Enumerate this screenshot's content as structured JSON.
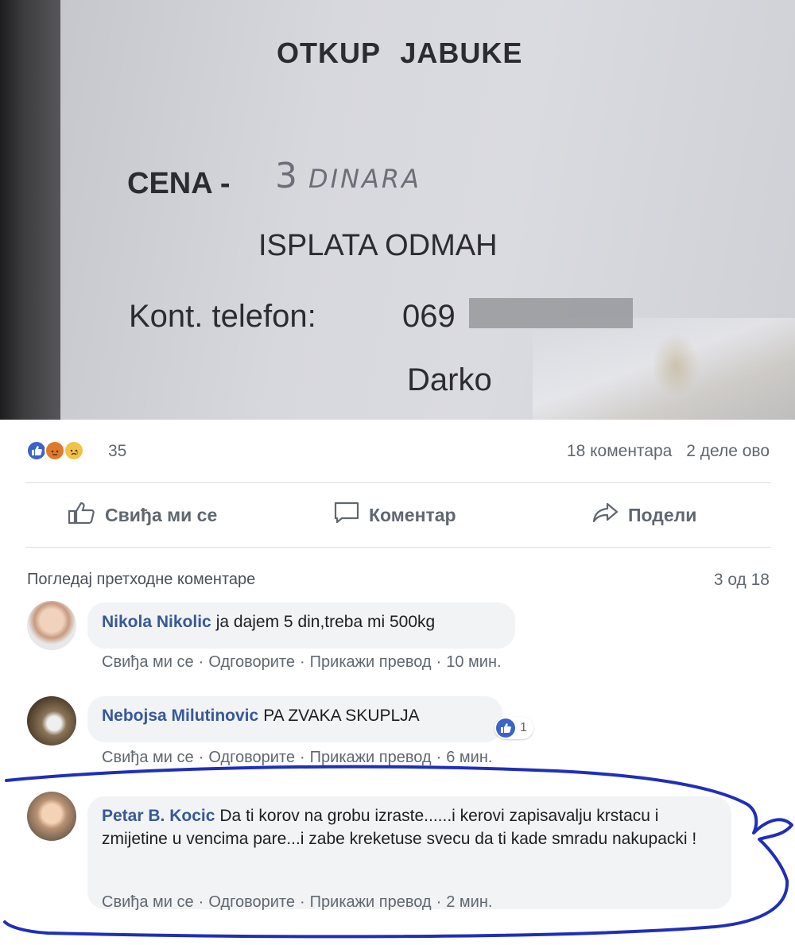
{
  "photo": {
    "title": "OTKUP JABUKE",
    "price_label": "CENA -",
    "price_number": "3",
    "price_currency": "DINARA",
    "payment": "ISPLATA ODMAH",
    "phone_label": "Kont. telefon:",
    "phone_prefix": "069",
    "contact_name": "Darko"
  },
  "reactions": {
    "count": "35",
    "icons": [
      "like-icon",
      "angry-icon",
      "sad-icon"
    ],
    "comments_count": "18 коментара",
    "shares_count": "2 деле ово"
  },
  "actions": {
    "like": "Свиђа ми се",
    "comment": "Коментар",
    "share": "Подели"
  },
  "comments_header": {
    "view_previous": "Погледај претходне коментаре",
    "counter": "3 од 18"
  },
  "comments": [
    {
      "author": "Nikola Nikolic",
      "text": "ja dajem 5 din,treba mi 500kg",
      "like": "Свиђа ми се",
      "reply": "Одговорите",
      "translate": "Прикажи превод",
      "time": "10 мин."
    },
    {
      "author": "Nebojsa Milutinovic",
      "text": "PA ZVAKA SKUPLJA",
      "likes": "1",
      "like": "Свиђа ми се",
      "reply": "Одговорите",
      "translate": "Прикажи превод",
      "time": "6 мин."
    },
    {
      "author": "Petar B. Kocic",
      "text": "Da ti korov na grobu izraste......i kerovi zapisavalju krstacu i zmijetine u vencima pare...i zabe kreketuse svecu da ti kade smradu nakupacki !",
      "like": "Свиђа ми се",
      "reply": "Одговорите",
      "translate": "Прикажи превод",
      "time": "2 мин."
    }
  ],
  "colors": {
    "link": "#385898",
    "meta": "#606770",
    "annotation": "#1f2fb8",
    "like_blue": "#3b63c9"
  }
}
